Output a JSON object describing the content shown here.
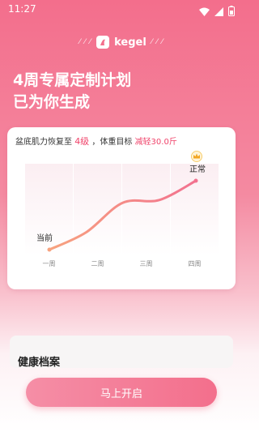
{
  "status_bar": {
    "time": "11:27",
    "icons": [
      "wifi-icon",
      "signal-icon",
      "battery-icon"
    ]
  },
  "brand": {
    "name": "kegel",
    "logo_icon": "kegel-logo-icon"
  },
  "headline": {
    "line1": "4周专属定制计划",
    "line2": "已为你生成"
  },
  "plan_card": {
    "summary_prefix": "盆底肌力恢复至",
    "level": "4级",
    "weight_prefix": "，体重目标",
    "weight_goal": "减轻30.0斤"
  },
  "chart_data": {
    "type": "line",
    "categories": [
      "一周",
      "二周",
      "三周",
      "四周"
    ],
    "y_is_relative": true,
    "points": [
      {
        "x": 0.0,
        "y": 0.0
      },
      {
        "x": 0.25,
        "y": 0.25
      },
      {
        "x": 0.5,
        "y": 0.68
      },
      {
        "x": 0.75,
        "y": 0.72
      },
      {
        "x": 1.0,
        "y": 1.0
      }
    ],
    "start_label": "当前",
    "end_label": "正常",
    "end_marker_icon": "crown-icon",
    "colors": {
      "line_start": "#f7a37f",
      "line_end": "#f2728f",
      "column_fill": "#fbeef2",
      "tick_label": "#888888"
    }
  },
  "health_panel": {
    "title": "健康档案"
  },
  "cta": {
    "label": "马上开启"
  },
  "colors": {
    "accent": "#f0436a",
    "background_top": "#f36e8c",
    "button": "#f36f8c"
  }
}
